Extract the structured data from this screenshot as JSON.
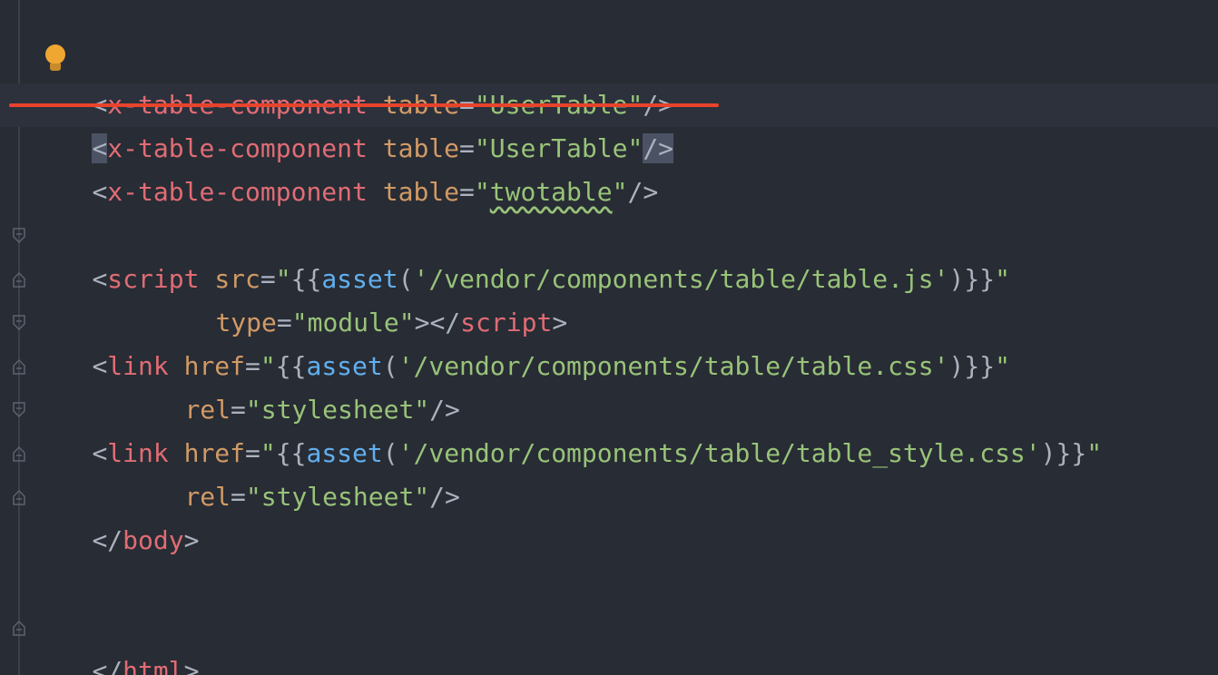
{
  "editor": {
    "lines": [
      {
        "tokens": [
          "<",
          "x-table-component",
          " ",
          "table",
          "=",
          "\"UserTable\"",
          "/>"
        ]
      },
      {
        "tokens": [
          "<",
          "x-table-component",
          " ",
          "table",
          "=",
          "\"UserTable\"",
          "/>"
        ]
      },
      {
        "tokens": [
          "<",
          "x-table-component",
          " ",
          "table",
          "=",
          "\"",
          "twotable",
          "\"",
          "/>"
        ]
      },
      {
        "script_open": {
          "lt": "<",
          "tag": "script",
          "attr": "src",
          "eq": "=",
          "q1": "\"",
          "braces_open": "{{",
          "fn": "asset",
          "paren_open": "(",
          "arg": "'/vendor/components/table/table.js'",
          "paren_close": ")",
          "braces_close": "}}",
          "q2": "\""
        }
      },
      {
        "script_type": {
          "attr": "type",
          "eq": "=",
          "val": "\"module\"",
          "gt": "></",
          "tag": "script",
          "end": ">"
        }
      },
      {
        "link1": {
          "lt": "<",
          "tag": "link",
          "attr": "href",
          "eq": "=",
          "q1": "\"",
          "braces_open": "{{",
          "fn": "asset",
          "paren_open": "(",
          "arg": "'/vendor/components/table/table.css'",
          "paren_close": ")",
          "braces_close": "}}",
          "q2": "\""
        }
      },
      {
        "rel1": {
          "attr": "rel",
          "eq": "=",
          "val": "\"stylesheet\"",
          "end": "/>"
        }
      },
      {
        "link2": {
          "lt": "<",
          "tag": "link",
          "attr": "href",
          "eq": "=",
          "q1": "\"",
          "braces_open": "{{",
          "fn": "asset",
          "paren_open": "(",
          "arg": "'/vendor/components/table/table_style.css'",
          "paren_close": ")",
          "braces_close": "}}",
          "q2": "\""
        }
      },
      {
        "rel2": {
          "attr": "rel",
          "eq": "=",
          "val": "\"stylesheet\"",
          "end": "/>"
        }
      },
      {
        "body_close": {
          "lt": "</",
          "tag": "body",
          "gt": ">"
        }
      },
      {
        "html_close": {
          "lt": "</",
          "tag": "html",
          "gt": ">"
        }
      }
    ]
  },
  "colors": {
    "background": "#282c34",
    "tag": "#e06c75",
    "attribute": "#d19a66",
    "string": "#98c379",
    "function": "#61afef",
    "strike": "#e8432c",
    "bulb": "#f0a732"
  },
  "icons": [
    "lightbulb-icon",
    "fold-icon"
  ]
}
